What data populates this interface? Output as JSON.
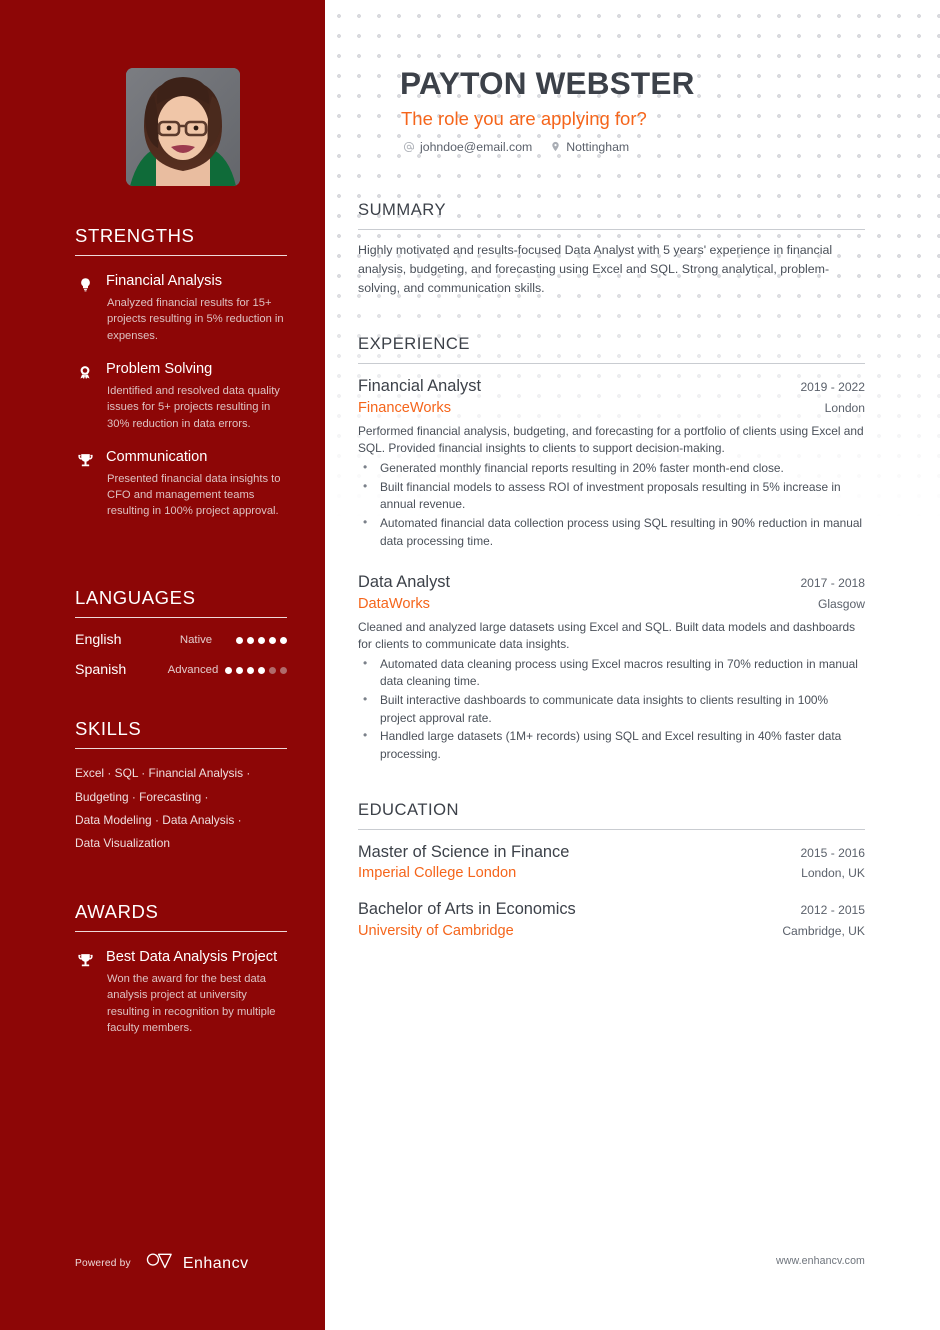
{
  "colors": {
    "sidebar_bg": "#8d0606",
    "accent_orange": "#f5651b",
    "heading_dark": "#3c4149",
    "body_text": "#4a5059"
  },
  "header": {
    "name": "PAYTON WEBSTER",
    "role": "The role you are applying for?",
    "email": "johndoe@email.com",
    "email_icon": "at-sign-icon",
    "location": "Nottingham",
    "location_icon": "map-pin-icon",
    "photo_alt": "profile-photo"
  },
  "sidebar": {
    "strengths": {
      "title": "STRENGTHS",
      "items": [
        {
          "icon": "lightbulb-icon",
          "title": "Financial Analysis",
          "description": "Analyzed financial results for 15+ projects resulting in 5% reduction in expenses."
        },
        {
          "icon": "award-ribbon-icon",
          "title": "Problem Solving",
          "description": "Identified and resolved data quality issues for 5+ projects resulting in 30% reduction in data errors."
        },
        {
          "icon": "trophy-icon",
          "title": "Communication",
          "description": "Presented financial data insights to CFO and management teams resulting in 100% project approval."
        }
      ]
    },
    "languages": {
      "title": "LANGUAGES",
      "items": [
        {
          "name": "English",
          "level": "Native",
          "dots_filled": 5,
          "dots_total": 5
        },
        {
          "name": "Spanish",
          "level": "Advanced",
          "dots_filled": 4,
          "dots_total": 6
        }
      ]
    },
    "skills": {
      "title": "SKILLS",
      "lines": [
        "Excel · SQL · Financial Analysis ·",
        "Budgeting · Forecasting ·",
        "Data Modeling · Data Analysis ·",
        "Data Visualization"
      ]
    },
    "awards": {
      "title": "AWARDS",
      "items": [
        {
          "icon": "trophy-icon",
          "title": "Best Data Analysis Project",
          "description": "Won the award for the best data analysis project at university resulting in recognition by multiple faculty members."
        }
      ]
    },
    "footer": {
      "powered_by": "Powered by",
      "brand": "Enhancv",
      "brand_icon": "enhancv-logo-icon"
    }
  },
  "main": {
    "summary": {
      "title": "SUMMARY",
      "text": "Highly motivated and results-focused Data Analyst with 5 years' experience in financial analysis, budgeting, and forecasting using Excel and SQL. Strong analytical, problem-solving, and communication skills."
    },
    "experience": {
      "title": "EXPERIENCE",
      "entries": [
        {
          "title": "Financial Analyst",
          "date": "2019 - 2022",
          "organization": "FinanceWorks",
          "location": "London",
          "description": "Performed financial analysis, budgeting, and forecasting for a portfolio of clients using Excel and SQL. Provided financial insights to clients to support decision-making.",
          "bullets": [
            "Generated monthly financial reports resulting in 20% faster month-end close.",
            "Built financial models to assess ROI of investment proposals resulting in 5% increase in annual revenue.",
            "Automated financial data collection process using SQL resulting in 90% reduction in manual data processing time."
          ]
        },
        {
          "title": "Data Analyst",
          "date": "2017 - 2018",
          "organization": "DataWorks",
          "location": "Glasgow",
          "description": "Cleaned and analyzed large datasets using Excel and SQL. Built data models and dashboards for clients to communicate data insights.",
          "bullets": [
            "Automated data cleaning process using Excel macros resulting in 70% reduction in manual data cleaning time.",
            "Built interactive dashboards to communicate data insights to clients resulting in 100% project approval rate.",
            "Handled large datasets (1M+ records) using SQL and Excel resulting in 40% faster data processing."
          ]
        }
      ]
    },
    "education": {
      "title": "EDUCATION",
      "entries": [
        {
          "title": "Master of Science in Finance",
          "date": "2015 - 2016",
          "organization": "Imperial College London",
          "location": "London, UK"
        },
        {
          "title": "Bachelor of Arts in Economics",
          "date": "2012 - 2015",
          "organization": "University of Cambridge",
          "location": "Cambridge, UK"
        }
      ]
    },
    "footer_url": "www.enhancv.com"
  }
}
